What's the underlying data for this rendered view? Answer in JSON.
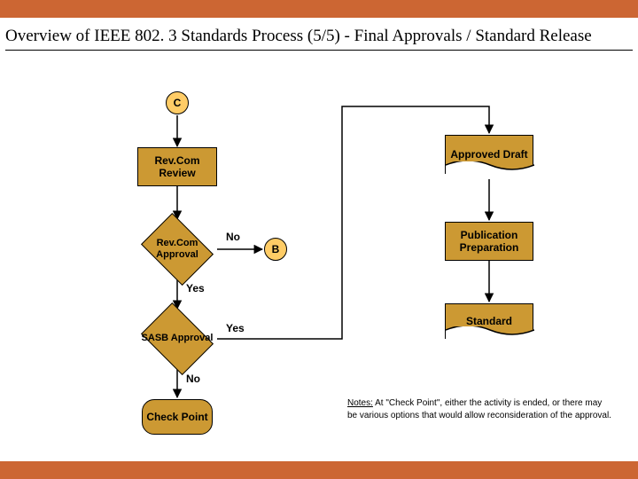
{
  "title": "Overview of IEEE 802. 3 Standards Process (5/5) - Final Approvals / Standard Release",
  "nodes": {
    "c": "C",
    "b": "B",
    "revcom_review": "Rev.Com Review",
    "revcom_approval": "Rev.Com Approval",
    "sasb_approval": "SASB Approval",
    "check_point": "Check Point",
    "approved_draft": "Approved Draft",
    "pub_prep": "Publication Preparation",
    "standard": "Standard"
  },
  "labels": {
    "no": "No",
    "yes": "Yes"
  },
  "notes": {
    "heading": "Notes:",
    "body": "At \"Check Point\", either the activity is ended, or there may be various options that would allow reconsideration of the approval."
  }
}
